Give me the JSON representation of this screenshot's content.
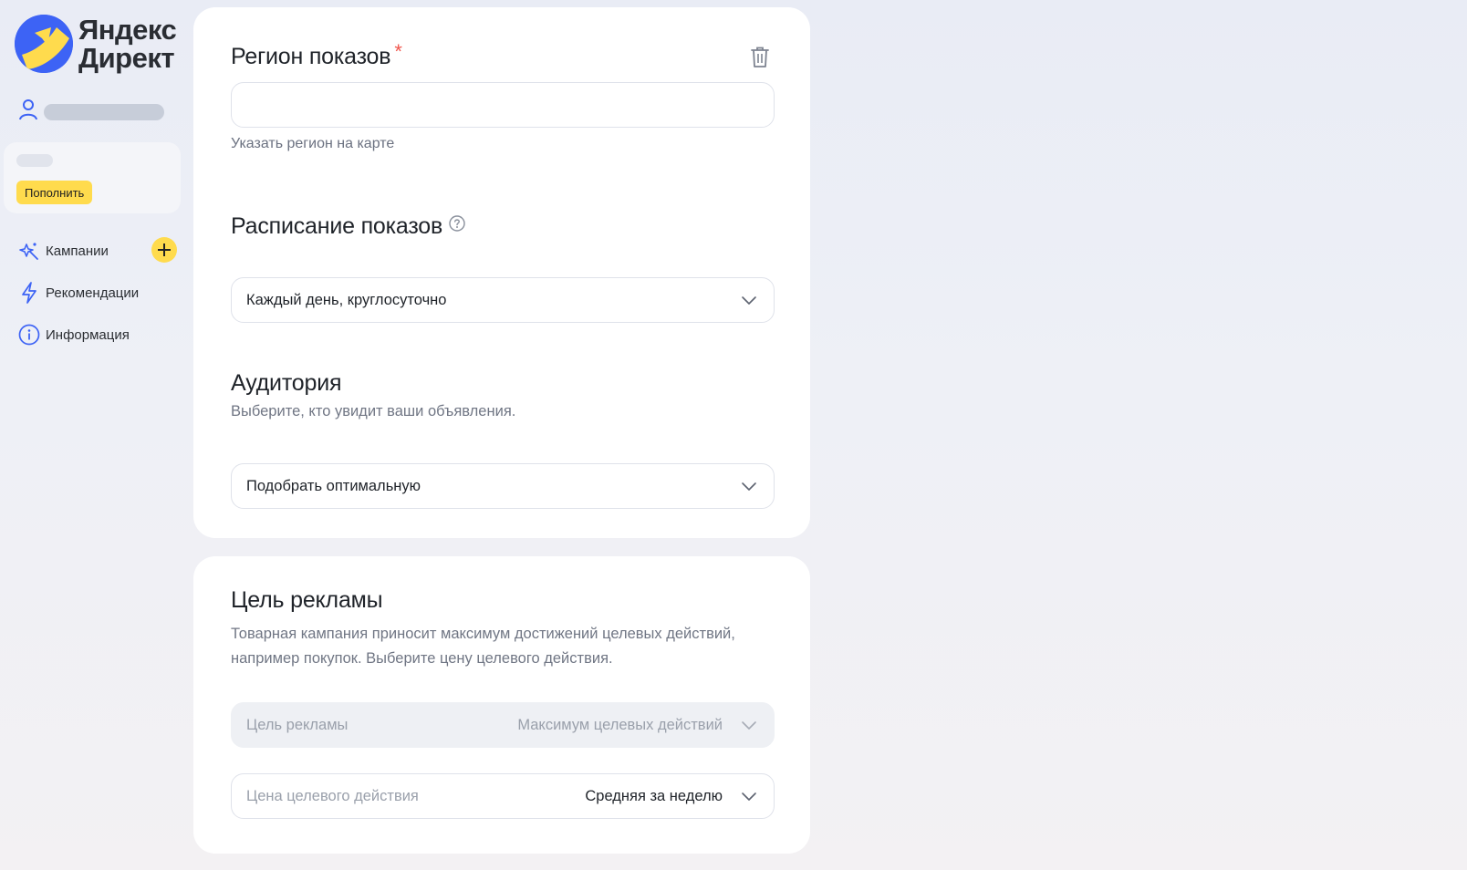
{
  "brand": {
    "line1": "Яндекс",
    "line2": "Директ"
  },
  "sidebar": {
    "topup_label": "Пополнить",
    "nav": [
      {
        "label": "Кампании",
        "icon": "campaigns-sparkle-icon"
      },
      {
        "label": "Рекомендации",
        "icon": "lightning-icon"
      },
      {
        "label": "Информация",
        "icon": "info-icon"
      }
    ]
  },
  "region": {
    "title": "Регион показов",
    "required_mark": "*",
    "input_value": "",
    "map_link": "Указать регион на карте"
  },
  "schedule": {
    "title": "Расписание показов",
    "value": "Каждый день, круглосуточно"
  },
  "audience": {
    "title": "Аудитория",
    "description": "Выберите, кто увидит ваши объявления.",
    "value": "Подобрать оптимальную"
  },
  "goal": {
    "title": "Цель рекламы",
    "description": "Товарная кампания приносит максимум достижений целевых действий, например покупок. Выберите цену целевого действия.",
    "goal_select": {
      "label": "Цель рекламы",
      "value": "Максимум целевых действий"
    },
    "price_select": {
      "label": "Цена целевого действия",
      "value": "Средняя за неделю"
    }
  },
  "colors": {
    "accent_yellow": "#ffdb4d",
    "brand_blue": "#3d63f5",
    "required_red": "#f0564d"
  }
}
